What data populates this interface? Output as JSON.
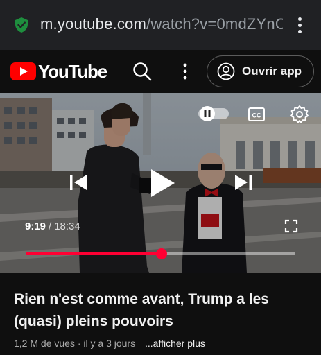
{
  "browser": {
    "url_host": "m.youtube.com",
    "url_path": "/watch?v=0mdZYnC",
    "menu_icon": "more-vert-icon",
    "secure_icon": "shield-check-icon"
  },
  "header": {
    "logo_text": "YouTube",
    "open_app_label": "Ouvrir app",
    "icons": [
      "search-icon",
      "more-vert-icon",
      "account-icon"
    ]
  },
  "player": {
    "current_time": "9:19",
    "separator": "/",
    "duration": "18:34",
    "progress_fraction": 0.502,
    "icons": [
      "autoplay-toggle-icon",
      "captions-icon",
      "settings-gear-icon",
      "previous-icon",
      "play-icon",
      "next-icon",
      "fullscreen-icon"
    ],
    "accent_color": "#ff0033"
  },
  "video": {
    "title": "Rien n'est comme avant, Trump a les (quasi) pleins pouvoirs",
    "views": "1,2 M de vues",
    "dot": "·",
    "age": "il y a 3 jours",
    "more_label": "...afficher plus"
  }
}
